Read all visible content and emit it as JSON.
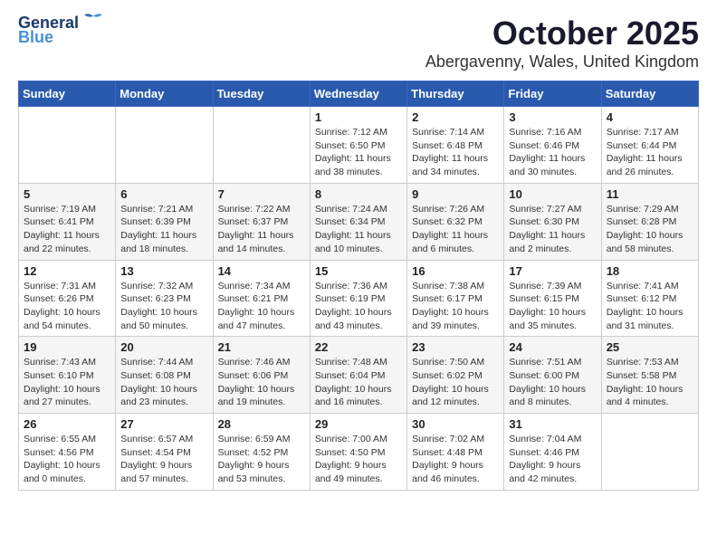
{
  "header": {
    "logo_line1": "General",
    "logo_line2": "Blue",
    "month": "October 2025",
    "location": "Abergavenny, Wales, United Kingdom"
  },
  "weekdays": [
    "Sunday",
    "Monday",
    "Tuesday",
    "Wednesday",
    "Thursday",
    "Friday",
    "Saturday"
  ],
  "weeks": [
    [
      {
        "day": "",
        "info": ""
      },
      {
        "day": "",
        "info": ""
      },
      {
        "day": "",
        "info": ""
      },
      {
        "day": "1",
        "info": "Sunrise: 7:12 AM\nSunset: 6:50 PM\nDaylight: 11 hours and 38 minutes."
      },
      {
        "day": "2",
        "info": "Sunrise: 7:14 AM\nSunset: 6:48 PM\nDaylight: 11 hours and 34 minutes."
      },
      {
        "day": "3",
        "info": "Sunrise: 7:16 AM\nSunset: 6:46 PM\nDaylight: 11 hours and 30 minutes."
      },
      {
        "day": "4",
        "info": "Sunrise: 7:17 AM\nSunset: 6:44 PM\nDaylight: 11 hours and 26 minutes."
      }
    ],
    [
      {
        "day": "5",
        "info": "Sunrise: 7:19 AM\nSunset: 6:41 PM\nDaylight: 11 hours and 22 minutes."
      },
      {
        "day": "6",
        "info": "Sunrise: 7:21 AM\nSunset: 6:39 PM\nDaylight: 11 hours and 18 minutes."
      },
      {
        "day": "7",
        "info": "Sunrise: 7:22 AM\nSunset: 6:37 PM\nDaylight: 11 hours and 14 minutes."
      },
      {
        "day": "8",
        "info": "Sunrise: 7:24 AM\nSunset: 6:34 PM\nDaylight: 11 hours and 10 minutes."
      },
      {
        "day": "9",
        "info": "Sunrise: 7:26 AM\nSunset: 6:32 PM\nDaylight: 11 hours and 6 minutes."
      },
      {
        "day": "10",
        "info": "Sunrise: 7:27 AM\nSunset: 6:30 PM\nDaylight: 11 hours and 2 minutes."
      },
      {
        "day": "11",
        "info": "Sunrise: 7:29 AM\nSunset: 6:28 PM\nDaylight: 10 hours and 58 minutes."
      }
    ],
    [
      {
        "day": "12",
        "info": "Sunrise: 7:31 AM\nSunset: 6:26 PM\nDaylight: 10 hours and 54 minutes."
      },
      {
        "day": "13",
        "info": "Sunrise: 7:32 AM\nSunset: 6:23 PM\nDaylight: 10 hours and 50 minutes."
      },
      {
        "day": "14",
        "info": "Sunrise: 7:34 AM\nSunset: 6:21 PM\nDaylight: 10 hours and 47 minutes."
      },
      {
        "day": "15",
        "info": "Sunrise: 7:36 AM\nSunset: 6:19 PM\nDaylight: 10 hours and 43 minutes."
      },
      {
        "day": "16",
        "info": "Sunrise: 7:38 AM\nSunset: 6:17 PM\nDaylight: 10 hours and 39 minutes."
      },
      {
        "day": "17",
        "info": "Sunrise: 7:39 AM\nSunset: 6:15 PM\nDaylight: 10 hours and 35 minutes."
      },
      {
        "day": "18",
        "info": "Sunrise: 7:41 AM\nSunset: 6:12 PM\nDaylight: 10 hours and 31 minutes."
      }
    ],
    [
      {
        "day": "19",
        "info": "Sunrise: 7:43 AM\nSunset: 6:10 PM\nDaylight: 10 hours and 27 minutes."
      },
      {
        "day": "20",
        "info": "Sunrise: 7:44 AM\nSunset: 6:08 PM\nDaylight: 10 hours and 23 minutes."
      },
      {
        "day": "21",
        "info": "Sunrise: 7:46 AM\nSunset: 6:06 PM\nDaylight: 10 hours and 19 minutes."
      },
      {
        "day": "22",
        "info": "Sunrise: 7:48 AM\nSunset: 6:04 PM\nDaylight: 10 hours and 16 minutes."
      },
      {
        "day": "23",
        "info": "Sunrise: 7:50 AM\nSunset: 6:02 PM\nDaylight: 10 hours and 12 minutes."
      },
      {
        "day": "24",
        "info": "Sunrise: 7:51 AM\nSunset: 6:00 PM\nDaylight: 10 hours and 8 minutes."
      },
      {
        "day": "25",
        "info": "Sunrise: 7:53 AM\nSunset: 5:58 PM\nDaylight: 10 hours and 4 minutes."
      }
    ],
    [
      {
        "day": "26",
        "info": "Sunrise: 6:55 AM\nSunset: 4:56 PM\nDaylight: 10 hours and 0 minutes."
      },
      {
        "day": "27",
        "info": "Sunrise: 6:57 AM\nSunset: 4:54 PM\nDaylight: 9 hours and 57 minutes."
      },
      {
        "day": "28",
        "info": "Sunrise: 6:59 AM\nSunset: 4:52 PM\nDaylight: 9 hours and 53 minutes."
      },
      {
        "day": "29",
        "info": "Sunrise: 7:00 AM\nSunset: 4:50 PM\nDaylight: 9 hours and 49 minutes."
      },
      {
        "day": "30",
        "info": "Sunrise: 7:02 AM\nSunset: 4:48 PM\nDaylight: 9 hours and 46 minutes."
      },
      {
        "day": "31",
        "info": "Sunrise: 7:04 AM\nSunset: 4:46 PM\nDaylight: 9 hours and 42 minutes."
      },
      {
        "day": "",
        "info": ""
      }
    ]
  ]
}
